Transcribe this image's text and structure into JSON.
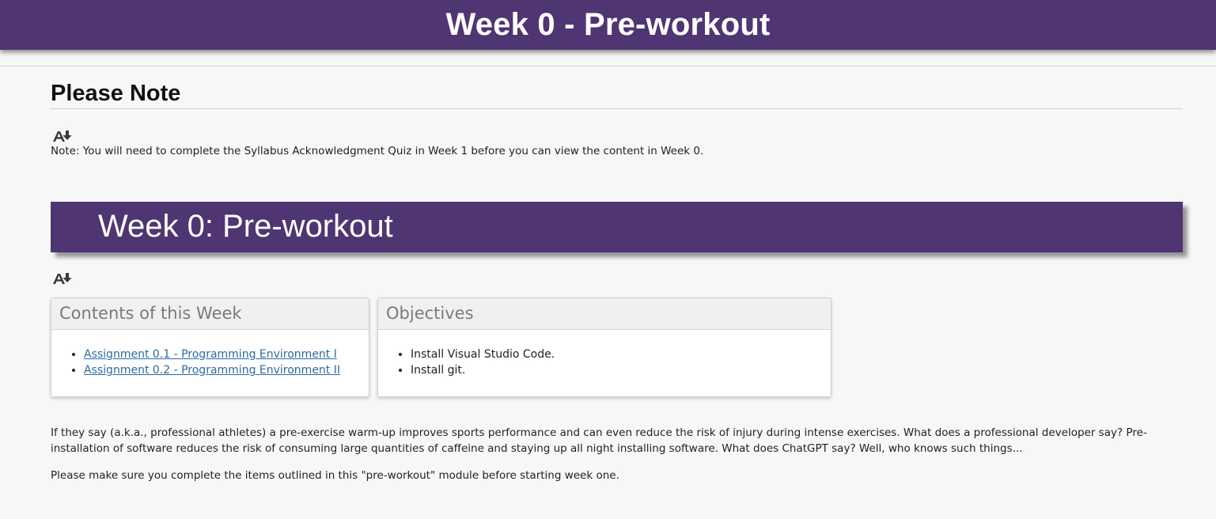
{
  "page": {
    "banner_title": "Week 0 - Pre-workout"
  },
  "note_section": {
    "heading": "Please Note",
    "text": "Note:  You will need to complete the Syllabus Acknowledgment Quiz in Week 1 before you can view the content in Week 0."
  },
  "week_banner": {
    "title": "Week 0: Pre-workout"
  },
  "contents_panel": {
    "heading": "Contents of this Week",
    "items": [
      "Assignment 0.1 - Programming Environment I",
      "Assignment 0.2 - Programming Environment II"
    ]
  },
  "objectives_panel": {
    "heading": "Objectives",
    "items": [
      "Install Visual Studio Code.",
      "Install git."
    ]
  },
  "body": {
    "paragraph_1": "If they say (a.k.a., professional athletes) a pre-exercise warm-up improves sports performance and can even reduce the risk of injury during intense exercises.  What does a professional developer say?  Pre-installation of software reduces the risk of consuming large quantities of caffeine and staying up all night installing software.  What does ChatGPT say?  Well, who knows such things...",
    "paragraph_2": "Please make sure you complete the items outlined in this \"pre-workout\" module before starting week one."
  },
  "icons": {
    "accessibility": "alternative-formats-icon"
  },
  "colors": {
    "brand_purple": "#4f3673",
    "link_blue": "#2b6aa3",
    "page_background": "#f7f7f7"
  }
}
